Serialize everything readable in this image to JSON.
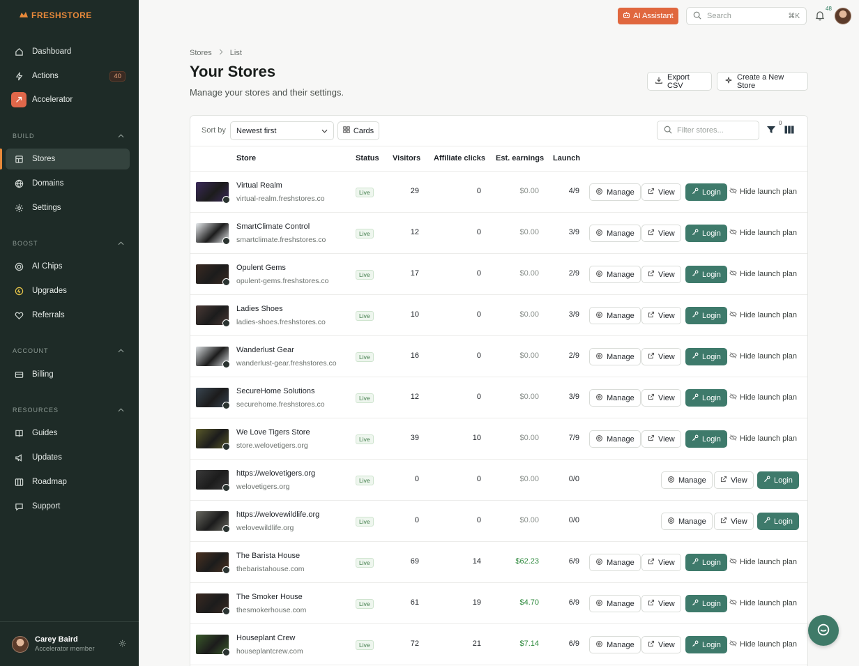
{
  "brand": {
    "logo_fresh": "FRESH",
    "logo_store": "STORE"
  },
  "sidebar": {
    "main": [
      {
        "label": "Dashboard",
        "icon": "home-icon"
      },
      {
        "label": "Actions",
        "icon": "bolt-icon",
        "badge": "40"
      },
      {
        "label": "Accelerator",
        "icon": "accelerator-icon"
      }
    ],
    "build_label": "BUILD",
    "build": [
      {
        "label": "Stores",
        "icon": "store-icon"
      },
      {
        "label": "Domains",
        "icon": "globe-icon"
      },
      {
        "label": "Settings",
        "icon": "gear-icon"
      }
    ],
    "boost_label": "BOOST",
    "boost": [
      {
        "label": "AI Chips",
        "icon": "chip-icon"
      },
      {
        "label": "Upgrades",
        "icon": "upgrade-icon"
      },
      {
        "label": "Referrals",
        "icon": "heart-icon"
      }
    ],
    "account_label": "ACCOUNT",
    "account": [
      {
        "label": "Billing",
        "icon": "card-icon"
      }
    ],
    "resources_label": "RESOURCES",
    "resources": [
      {
        "label": "Guides",
        "icon": "book-icon"
      },
      {
        "label": "Updates",
        "icon": "megaphone-icon"
      },
      {
        "label": "Roadmap",
        "icon": "map-icon"
      },
      {
        "label": "Support",
        "icon": "chat-icon"
      }
    ],
    "user": {
      "name": "Carey Baird",
      "role": "Accelerator member"
    }
  },
  "topbar": {
    "ai_label": "AI Assistant",
    "search_placeholder": "Search",
    "search_kbd": "⌘K",
    "notif_count": "48"
  },
  "header": {
    "crumbs": [
      "Stores",
      "List"
    ],
    "title": "Your Stores",
    "subtitle": "Manage your stores and their settings.",
    "export_label": "Export CSV",
    "create_label": "Create a New Store"
  },
  "toolbar": {
    "sort_label": "Sort by",
    "sort_value": "Newest first",
    "cards_label": "Cards",
    "filter_placeholder": "Filter stores...",
    "filter_count": "0"
  },
  "table": {
    "headers": [
      "Store",
      "Status",
      "Visitors",
      "Affiliate clicks",
      "Est. earnings",
      "Launch"
    ],
    "manage_label": "Manage",
    "view_label": "View",
    "login_label": "Login",
    "hide_label": "Hide launch plan",
    "rows": [
      {
        "name": "Virtual Realm",
        "domain": "virtual-realm.freshstores.co",
        "status": "Live",
        "visitors": "29",
        "clicks": "0",
        "earnings": "$0.00",
        "launch": "4/9",
        "plan": true,
        "thumb": "#3b2a5a"
      },
      {
        "name": "SmartClimate Control",
        "domain": "smartclimate.freshstores.co",
        "status": "Live",
        "visitors": "12",
        "clicks": "0",
        "earnings": "$0.00",
        "launch": "3/9",
        "plan": true,
        "thumb": "#e9ecef"
      },
      {
        "name": "Opulent Gems",
        "domain": "opulent-gems.freshstores.co",
        "status": "Live",
        "visitors": "17",
        "clicks": "0",
        "earnings": "$0.00",
        "launch": "2/9",
        "plan": true,
        "thumb": "#3a2a22"
      },
      {
        "name": "Ladies Shoes",
        "domain": "ladies-shoes.freshstores.co",
        "status": "Live",
        "visitors": "10",
        "clicks": "0",
        "earnings": "$0.00",
        "launch": "3/9",
        "plan": true,
        "thumb": "#4a3a36"
      },
      {
        "name": "Wanderlust Gear",
        "domain": "wanderlust-gear.freshstores.co",
        "status": "Live",
        "visitors": "16",
        "clicks": "0",
        "earnings": "$0.00",
        "launch": "2/9",
        "plan": true,
        "thumb": "#d9dde0"
      },
      {
        "name": "SecureHome Solutions",
        "domain": "securehome.freshstores.co",
        "status": "Live",
        "visitors": "12",
        "clicks": "0",
        "earnings": "$0.00",
        "launch": "3/9",
        "plan": true,
        "thumb": "#3a4652"
      },
      {
        "name": "We Love Tigers Store",
        "domain": "store.welovetigers.org",
        "status": "Live",
        "visitors": "39",
        "clicks": "10",
        "earnings": "$0.00",
        "launch": "7/9",
        "plan": true,
        "thumb": "#5a5a2a"
      },
      {
        "name": "https://welovetigers.org",
        "domain": "welovetigers.org",
        "status": "Live",
        "visitors": "0",
        "clicks": "0",
        "earnings": "$0.00",
        "launch": "0/0",
        "plan": false,
        "thumb": "#3a3a3a"
      },
      {
        "name": "https://welovewildlife.org",
        "domain": "welovewildlife.org",
        "status": "Live",
        "visitors": "0",
        "clicks": "0",
        "earnings": "$0.00",
        "launch": "0/0",
        "plan": false,
        "thumb": "#6a6a62"
      },
      {
        "name": "The Barista House",
        "domain": "thebaristahouse.com",
        "status": "Live",
        "visitors": "69",
        "clicks": "14",
        "earnings": "$62.23",
        "launch": "6/9",
        "plan": true,
        "thumb": "#4a3222"
      },
      {
        "name": "The Smoker House",
        "domain": "thesmokerhouse.com",
        "status": "Live",
        "visitors": "61",
        "clicks": "19",
        "earnings": "$4.70",
        "launch": "6/9",
        "plan": true,
        "thumb": "#3a2a22"
      },
      {
        "name": "Houseplant Crew",
        "domain": "houseplantcrew.com",
        "status": "Live",
        "visitors": "72",
        "clicks": "21",
        "earnings": "$7.14",
        "launch": "6/9",
        "plan": true,
        "thumb": "#3a5a2a"
      }
    ]
  }
}
